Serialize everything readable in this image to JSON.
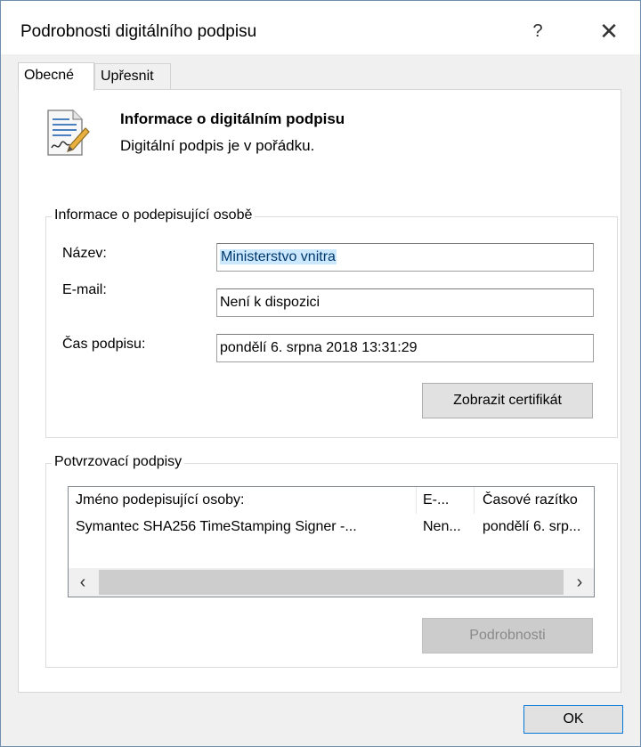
{
  "window": {
    "title": "Podrobnosti digitálního podpisu",
    "help_label": "?",
    "close_label": "✕"
  },
  "tabs": [
    {
      "label": "Obecné",
      "active": true
    },
    {
      "label": "Upřesnit",
      "active": false
    }
  ],
  "header": {
    "title": "Informace o digitálním podpisu",
    "status": "Digitální podpis je v pořádku."
  },
  "signer": {
    "legend": "Informace o podepisující osobě",
    "name_label": "Název:",
    "name_value": "Ministerstvo vnitra",
    "email_label": "E-mail:",
    "email_value": "Není k dispozici",
    "time_label": "Čas podpisu:",
    "time_value": "pondělí 6. srpna 2018 13:31:29",
    "view_cert_label": "Zobrazit certifikát"
  },
  "countersignatures": {
    "legend": "Potvrzovací podpisy",
    "columns": [
      "Jméno podepisující osoby:",
      "E-...",
      "Časové razítko"
    ],
    "rows": [
      [
        "Symantec SHA256 TimeStamping Signer -...",
        "Nen...",
        "pondělí 6. srp..."
      ]
    ],
    "details_label": "Podrobnosti",
    "scroll_left": "‹",
    "scroll_right": "›"
  },
  "footer": {
    "ok_label": "OK"
  }
}
